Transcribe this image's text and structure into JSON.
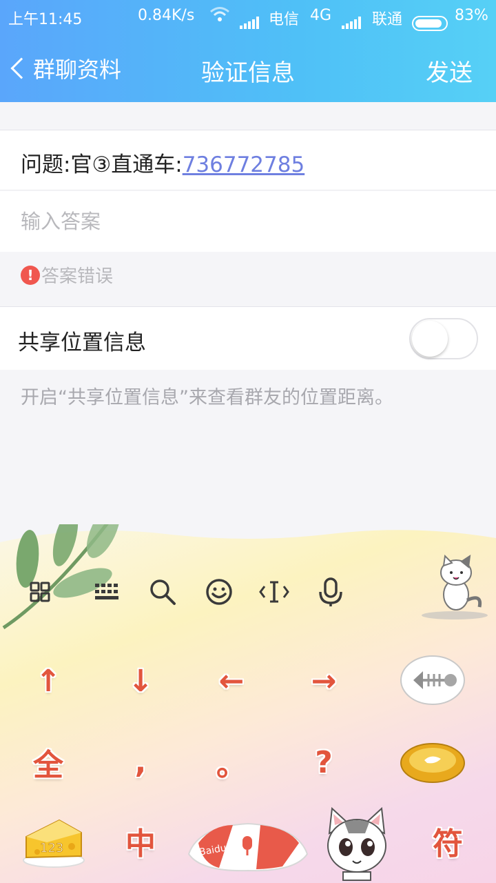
{
  "status_bar": {
    "time": "上午11:45",
    "speed": "0.84K/s",
    "carrier1": "电信",
    "network": "4G",
    "carrier2": "联通",
    "battery": "83%"
  },
  "nav": {
    "back_label": "群聊资料",
    "title": "验证信息",
    "send_label": "发送"
  },
  "question": {
    "prefix": "问题:官③直通车:",
    "link": "736772785"
  },
  "answer": {
    "placeholder": "输入答案",
    "value": ""
  },
  "error": {
    "icon": "!",
    "text": "答案错误"
  },
  "share_location": {
    "label": "共享位置信息",
    "enabled": false,
    "hint": "开启“共享位置信息”来查看群友的位置距离。"
  },
  "keyboard": {
    "toolbar_icons": [
      "grid-icon",
      "keyboard-icon",
      "search-icon",
      "emoji-icon",
      "cursor-icon",
      "microphone-icon"
    ],
    "row1": [
      "↑",
      "↓",
      "←",
      "→"
    ],
    "row2": [
      "全",
      ",",
      "。",
      "?"
    ],
    "row3": {
      "numeric_label": "123",
      "chinese_key": "中",
      "space_brand": "Baidu",
      "symbols_key": "符"
    },
    "colors": {
      "key_text": "#e2553d"
    }
  }
}
